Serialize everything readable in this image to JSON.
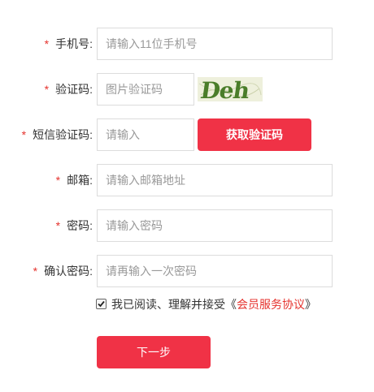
{
  "form": {
    "required_mark": "*",
    "phone": {
      "label": "手机号:",
      "placeholder": "请输入11位手机号"
    },
    "captcha": {
      "label": "验证码:",
      "placeholder": "图片验证码"
    },
    "sms": {
      "label": "短信验证码:",
      "placeholder": "请输入",
      "button": "获取验证码"
    },
    "email": {
      "label": "邮箱:",
      "placeholder": "请输入邮箱地址"
    },
    "password": {
      "label": "密码:",
      "placeholder": "请输入密码"
    },
    "confirm": {
      "label": "确认密码:",
      "placeholder": "请再输入一次密码"
    },
    "agreement": {
      "checked": true,
      "prefix": "我已阅读、理解并接受《",
      "link": "会员服务协议",
      "suffix": "》"
    },
    "next_button": "下一步"
  },
  "captcha_image": {
    "text": "Deh"
  },
  "colors": {
    "accent": "#f03246",
    "required": "#e5322d",
    "border": "#dcdcdc",
    "placeholder": "#999999"
  }
}
